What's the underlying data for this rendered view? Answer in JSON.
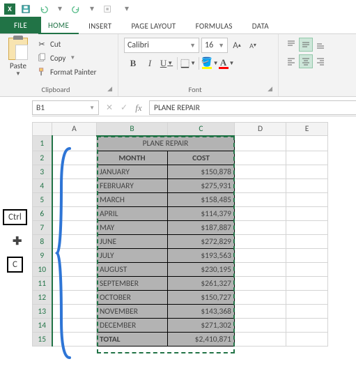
{
  "qat": {
    "save": "Save",
    "undo": "Undo",
    "redo": "Redo",
    "repeat": "Repeat"
  },
  "tabs": {
    "file": "FILE",
    "home": "HOME",
    "insert": "INSERT",
    "page_layout": "PAGE LAYOUT",
    "formulas": "FORMULAS",
    "data": "DATA"
  },
  "ribbon": {
    "clipboard": {
      "label": "Clipboard",
      "paste": "Paste",
      "cut": "Cut",
      "copy": "Copy",
      "format_painter": "Format Painter"
    },
    "font": {
      "label": "Font",
      "name": "Calibri",
      "size": "16"
    }
  },
  "name_box": "B1",
  "formula_value": "PLANE REPAIR",
  "columns": [
    "A",
    "B",
    "C",
    "D",
    "E"
  ],
  "row_numbers": [
    1,
    2,
    3,
    4,
    5,
    6,
    7,
    8,
    9,
    10,
    11,
    12,
    13,
    14,
    15
  ],
  "chart_data": {
    "type": "table",
    "title": "PLANE REPAIR",
    "headers": [
      "MONTH",
      "COST"
    ],
    "rows": [
      {
        "month": "JANUARY",
        "cost": "$150,878"
      },
      {
        "month": "FEBRUARY",
        "cost": "$275,931"
      },
      {
        "month": "MARCH",
        "cost": "$158,485"
      },
      {
        "month": "APRIL",
        "cost": "$114,379"
      },
      {
        "month": "MAY",
        "cost": "$187,887"
      },
      {
        "month": "JUNE",
        "cost": "$272,829"
      },
      {
        "month": "JULY",
        "cost": "$193,563"
      },
      {
        "month": "AUGUST",
        "cost": "$230,195"
      },
      {
        "month": "SEPTEMBER",
        "cost": "$261,327"
      },
      {
        "month": "OCTOBER",
        "cost": "$150,727"
      },
      {
        "month": "NOVEMBER",
        "cost": "$143,368"
      },
      {
        "month": "DECEMBER",
        "cost": "$271,302"
      }
    ],
    "total_label": "TOTAL",
    "total_value": "$2,410,871"
  },
  "shortcut": {
    "key1": "Ctrl",
    "plus": "+",
    "key2": "C"
  }
}
